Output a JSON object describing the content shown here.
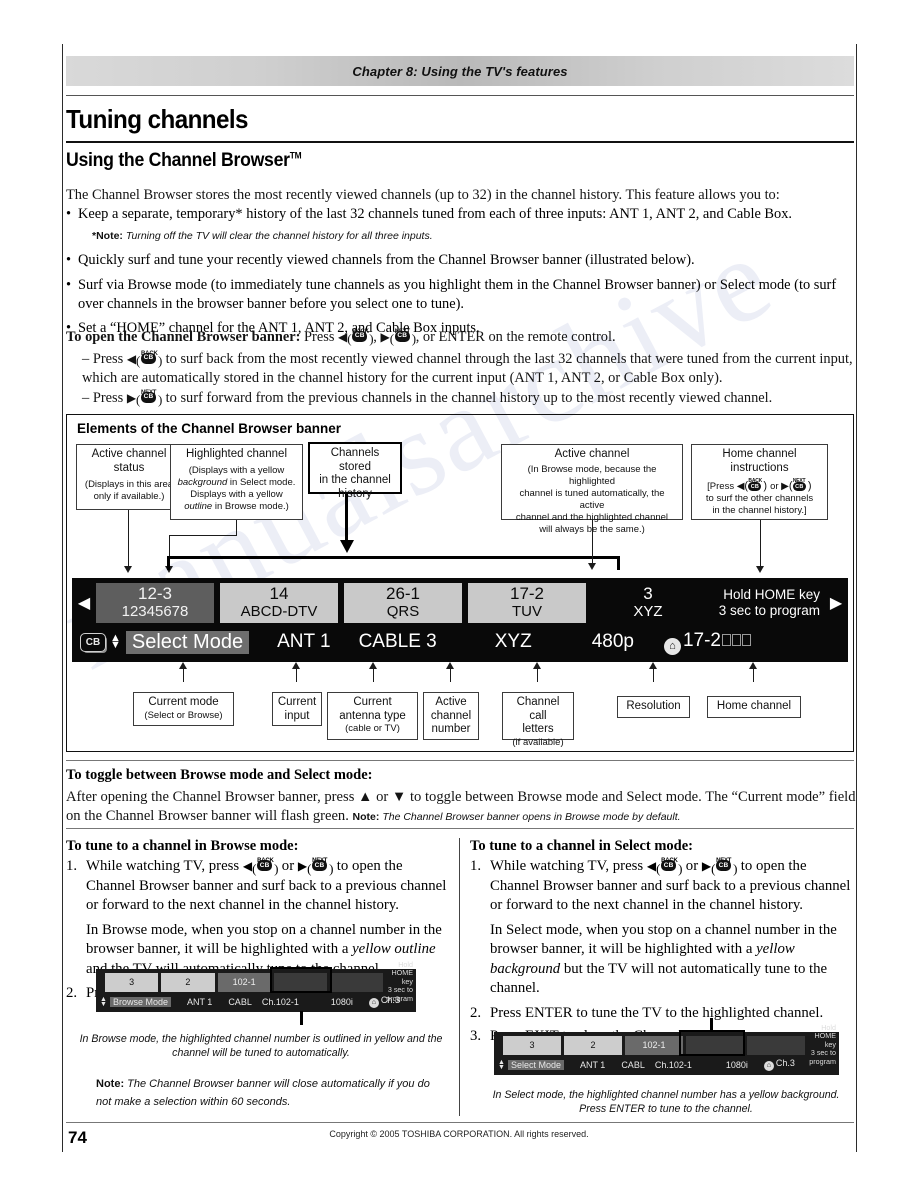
{
  "runhead": {
    "text": "Chapter 8: Using the TV's features"
  },
  "headings": {
    "h1": "Tuning channels",
    "h2": "Using the Channel Browser",
    "h2_tm": "TM"
  },
  "intro": "The Channel Browser stores the most recently viewed channels (up to 32) in the channel history. This feature allows you to:",
  "bullets": [
    "Keep a separate, temporary* history of the last 32 channels tuned from each of three inputs: ANT 1, ANT 2, and Cable Box.",
    "Quickly surf and tune your recently viewed channels from the Channel Browser banner (illustrated below).",
    "Surf via Browse mode (to immediately tune channels as you highlight them in the Channel Browser banner) or Select mode (to surf over channels in the browser banner before you select one to tune).",
    "Set a “HOME” channel for the ANT 1, ANT 2, and Cable Box inputs."
  ],
  "note_star": {
    "label": "*Note:",
    "text": "Turning off the TV will clear the channel history for all three inputs."
  },
  "open_banner": {
    "lead": "To open the Channel Browser banner:",
    "press": "Press",
    "mid": ",",
    "tail": ", or ENTER on the remote control.",
    "dash1_a": "Press",
    "dash1_b": "to surf back from the most recently viewed channel through the last 32 channels that were tuned from the current input, which are automatically stored in the channel history for the current input (ANT 1, ANT 2, or Cable Box only).",
    "dash2_a": "Press",
    "dash2_b": "to surf forward from the previous channels in the channel history up to the most recently viewed channel."
  },
  "keys": {
    "back_cap": "BACK",
    "next_cap": "NEXT",
    "cb": "CB",
    "left_tri": "◀",
    "right_tri": "▶",
    "or": "or"
  },
  "elements": {
    "title": "Elements of the Channel Browser banner",
    "callouts_top": [
      {
        "name": "active-channel-status",
        "head": "Active channel\nstatus",
        "sub": "(Displays in this area only if available.)"
      },
      {
        "name": "highlighted-channel",
        "head": "Highlighted channel",
        "sub_parts": [
          "(Displays with a yellow ",
          "background",
          " in Select mode. Displays with a yellow ",
          "outline",
          " in Browse mode.)"
        ]
      },
      {
        "name": "channels-stored",
        "head": "Channels stored\nin the channel\nhistory",
        "sub": ""
      },
      {
        "name": "active-channel",
        "head": "Active channel",
        "sub": "(In Browse mode, because the highlighted channel is tuned automatically, the active channel and the highlighted channel will always be the same.)"
      },
      {
        "name": "home-channel-instructions",
        "head": "Home channel instructions",
        "sub_a": "[Press",
        "sub_or": "or",
        "sub_b": "to surf the other channels in the channel history.]"
      }
    ],
    "callouts_bottom": [
      {
        "head": "Current mode",
        "sub": "(Select or Browse)"
      },
      {
        "head": "Current\ninput",
        "sub": ""
      },
      {
        "head": "Current\nantenna type",
        "sub": "(cable or TV)"
      },
      {
        "head": "Active\nchannel\nnumber",
        "sub": ""
      },
      {
        "head": "Channel call\nletters",
        "sub": "(if available)"
      },
      {
        "head": "Resolution",
        "sub": ""
      },
      {
        "head": "Home channel",
        "sub": ""
      }
    ]
  },
  "banner": {
    "left_arrow": "◀",
    "right_arrow": "▶",
    "tiles": [
      {
        "num": "12-3",
        "sub": "12345678",
        "style": "dark"
      },
      {
        "num": "14",
        "sub": "ABCD-DTV",
        "style": "light"
      },
      {
        "num": "26-1",
        "sub": "QRS",
        "style": "light"
      },
      {
        "num": "17-2",
        "sub": "TUV",
        "style": "light"
      },
      {
        "num": "3",
        "sub": "XYZ",
        "style": "plain"
      }
    ],
    "hold_line1": "Hold HOME key",
    "hold_line2": "3 sec to program",
    "cb_icon": "CB",
    "mode": "Select Mode",
    "input": "ANT 1",
    "antenna": "CABLE 3",
    "call_letters": "XYZ",
    "resolution": "480p",
    "home_channel": "17-2"
  },
  "toggle": {
    "head": "To toggle between Browse mode and Select mode:",
    "p1": "After opening the Channel Browser banner, press ▲ or ▼ to toggle between Browse mode and Select mode.  The “Current mode” field on the Channel Browser banner will flash green.",
    "note_label": "Note:",
    "note_text": "The Channel Browser banner opens in Browse mode by default."
  },
  "browse_col": {
    "head": "To tune to a channel in Browse mode:",
    "step1_a": "While watching TV, press",
    "step1_or": "or",
    "step1_b": "to open the Channel Browser banner and surf back to a previous channel or forward to the next channel in the channel history.",
    "para2_a": "In Browse mode, when you stop on a channel number in the browser banner, it will be highlighted with a ",
    "para2_em": "yellow outline",
    "para2_b": " and the TV will automatically tune to the channel.",
    "step2": "Press EXIT to close the Channel Browser banner.",
    "caption": "In Browse mode, the highlighted channel number is outlined in yellow and the channel will be tuned to automatically.",
    "note_label": "Note:",
    "note_text": "The Channel Browser banner will close automatically if you do not make a selection within 60 seconds.",
    "mini": {
      "tiles": [
        "3",
        "2",
        "102-1",
        "",
        ""
      ],
      "hold1": "Hold HOME key",
      "hold2": "3 sec to program",
      "mode": "Browse Mode",
      "input": "ANT 1",
      "antenna": "CABL",
      "channel": "Ch.102-1",
      "resolution": "1080i",
      "home": "Ch.3"
    }
  },
  "select_col": {
    "head": "To tune to a channel in Select mode:",
    "step1_a": "While watching TV, press",
    "step1_or": "or",
    "step1_b": "to open the Channel Browser banner and surf back to a previous channel or forward to the next channel in the channel history.",
    "para2_a": "In Select mode, when you stop on a channel number in the browser banner, it will be highlighted with a ",
    "para2_em": "yellow background",
    "para2_b": " but the TV will not automatically tune to the channel.",
    "step2": "Press ENTER to tune the TV to the highlighted channel.",
    "step3": "Press EXIT to close the Channel Browser banner.",
    "caption": "In Select mode, the highlighted channel number has a yellow background. Press ENTER to tune to the channel.",
    "mini": {
      "tiles": [
        "3",
        "2",
        "102-1",
        "",
        ""
      ],
      "hold1": "Hold HOME key",
      "hold2": "3 sec to program",
      "mode": "Select Mode",
      "input": "ANT 1",
      "antenna": "CABL",
      "channel": "Ch.102-1",
      "resolution": "1080i",
      "home": "Ch.3"
    }
  },
  "footer": {
    "page_number": "74",
    "copyright": "Copyright © 2005 TOSHIBA CORPORATION. All rights reserved."
  },
  "watermark": "manualsarchive",
  "colors": {
    "banner_bg": "#090909",
    "tile_light": "#c9c9c9",
    "tile_dark": "#5e5e5e",
    "rule": "#111111"
  }
}
